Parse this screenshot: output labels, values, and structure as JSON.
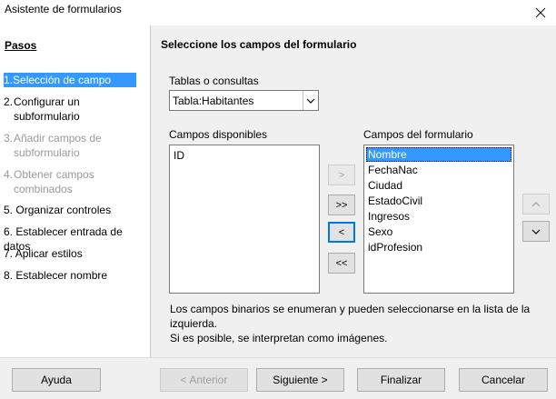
{
  "window": {
    "title": "Asistente de formularios"
  },
  "sidebar": {
    "header": "Pasos",
    "steps": [
      {
        "num": "1.",
        "label": "Selección de campo",
        "state": "active"
      },
      {
        "num": "2.",
        "label": "Configurar un subformulario",
        "state": "normal"
      },
      {
        "num": "3.",
        "label": "Añadir campos de subformulario",
        "state": "disabled"
      },
      {
        "num": "4.",
        "label": "Obtener campos combinados",
        "state": "disabled"
      },
      {
        "num": "5.",
        "label": "Organizar controles",
        "state": "normal"
      },
      {
        "num": "6.",
        "label": "Establecer entrada de datos",
        "state": "normal"
      },
      {
        "num": "7.",
        "label": "Aplicar estilos",
        "state": "normal"
      },
      {
        "num": "8.",
        "label": "Establecer nombre",
        "state": "normal"
      }
    ]
  },
  "main": {
    "title": "Seleccione los campos del formulario",
    "tables_label": "Tablas o consultas",
    "tables_value": "Tabla:Habitantes",
    "available_label": "Campos disponibles",
    "available_fields": [
      "ID"
    ],
    "form_label": "Campos del formulario",
    "form_fields": [
      "Nombre",
      "FechaNac",
      "Ciudad",
      "EstadoCivil",
      "Ingresos",
      "Sexo",
      "idProfesion"
    ],
    "move_buttons": {
      "add_one": ">",
      "add_all": ">>",
      "remove_one": "<",
      "remove_all": "<<"
    },
    "order_buttons": {
      "up": "^",
      "down": "v"
    },
    "info_line1": "Los campos binarios se enumeran y pueden seleccionarse en la lista de la izquierda.",
    "info_line2": "Si es posible, se interpretan como imágenes."
  },
  "footer": {
    "help": "Ayuda",
    "back": "< Anterior",
    "next": "Siguiente >",
    "finish": "Finalizar",
    "cancel": "Cancelar"
  }
}
